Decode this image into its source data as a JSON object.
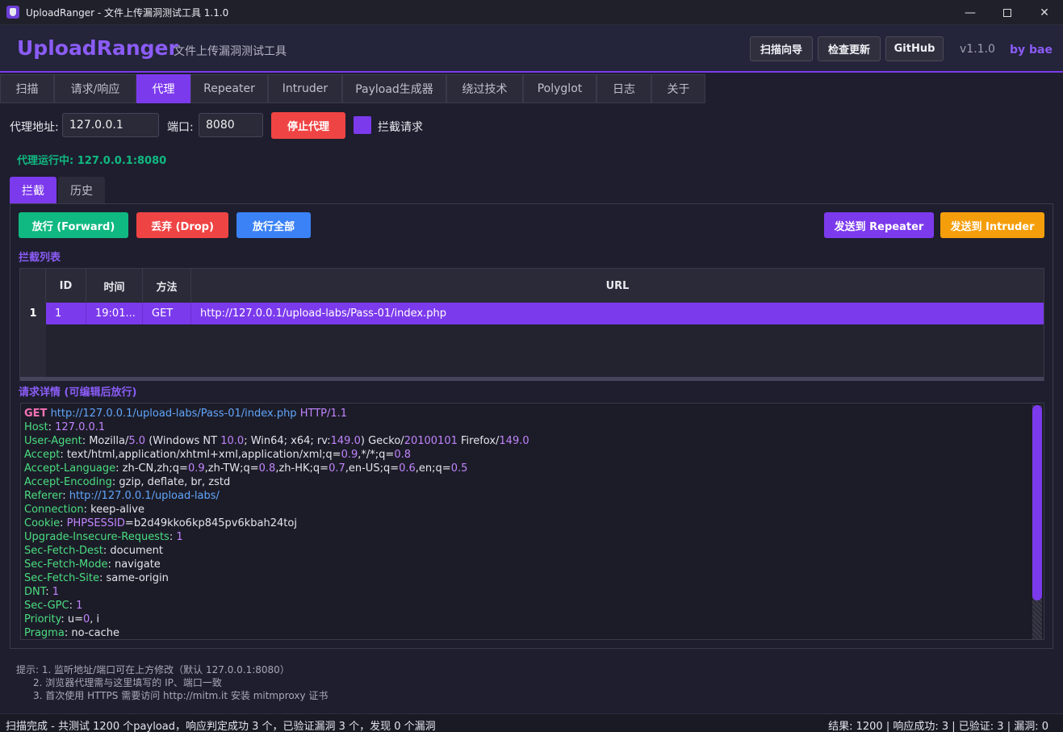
{
  "window": {
    "title": "UploadRanger - 文件上传漏洞测试工具 1.1.0",
    "minimize": "—",
    "close": "✕"
  },
  "header": {
    "brand": "UploadRanger",
    "subtitle": "文件上传漏洞测试工具",
    "buttons": [
      "扫描向导",
      "检查更新",
      "GitHub"
    ],
    "version": "v1.1.0",
    "byline": "by bae"
  },
  "tabs": [
    "扫描",
    "请求/响应",
    "代理",
    "Repeater",
    "Intruder",
    "Payload生成器",
    "绕过技术",
    "Polyglot",
    "日志",
    "关于"
  ],
  "proxy": {
    "address_label": "代理地址:",
    "address_value": "127.0.0.1",
    "port_label": "端口:",
    "port_value": "8080",
    "stop_button": "停止代理",
    "intercept_label": "拦截请求",
    "status": "代理运行中: 127.0.0.1:8080"
  },
  "subtabs": [
    "拦截",
    "历史"
  ],
  "actions": {
    "forward": "放行 (Forward)",
    "drop": "丢弃 (Drop)",
    "forward_all": "放行全部",
    "send_repeater": "发送到 Repeater",
    "send_intruder": "发送到 Intruder"
  },
  "intercept_list": {
    "title": "拦截列表",
    "columns": [
      "ID",
      "时间",
      "方法",
      "URL"
    ],
    "rows": [
      {
        "num": "1",
        "id": "1",
        "time": "19:01...",
        "method": "GET",
        "url": "http://127.0.0.1/upload-labs/Pass-01/index.php"
      }
    ]
  },
  "request_detail": {
    "title": "请求详情 (可编辑后放行)",
    "lines": [
      "GET http://127.0.0.1/upload-labs/Pass-01/index.php HTTP/1.1",
      "Host: 127.0.0.1",
      "User-Agent: Mozilla/5.0 (Windows NT 10.0; Win64; x64; rv:149.0) Gecko/20100101 Firefox/149.0",
      "Accept: text/html,application/xhtml+xml,application/xml;q=0.9,*/*;q=0.8",
      "Accept-Language: zh-CN,zh;q=0.9,zh-TW;q=0.8,zh-HK;q=0.7,en-US;q=0.6,en;q=0.5",
      "Accept-Encoding: gzip, deflate, br, zstd",
      "Referer: http://127.0.0.1/upload-labs/",
      "Connection: keep-alive",
      "Cookie: PHPSESSID=b2d49kko6kp845pv6kbah24toj",
      "Upgrade-Insecure-Requests: 1",
      "Sec-Fetch-Dest: document",
      "Sec-Fetch-Mode: navigate",
      "Sec-Fetch-Site: same-origin",
      "DNT: 1",
      "Sec-GPC: 1",
      "Priority: u=0, i",
      "Pragma: no-cache"
    ]
  },
  "hints": [
    "提示: 1. 监听地址/端口可在上方修改（默认 127.0.0.1:8080）",
    "2. 浏览器代理需与这里填写的 IP、端口一致",
    "3. 首次使用 HTTPS 需要访问 http://mitm.it 安装 mitmproxy 证书"
  ],
  "statusbar": {
    "left": "扫描完成 - 共测试 1200 个payload，响应判定成功 3 个，已验证漏洞 3 个，发现 0 个漏洞",
    "right": "结果: 1200 | 响应成功: 3 | 已验证: 3 | 漏洞: 0"
  },
  "colors": {
    "accent": "#7c3aed",
    "forward": "#10b981",
    "drop": "#ef4444",
    "forward_all": "#3b82f6",
    "intruder": "#f59e0b"
  }
}
